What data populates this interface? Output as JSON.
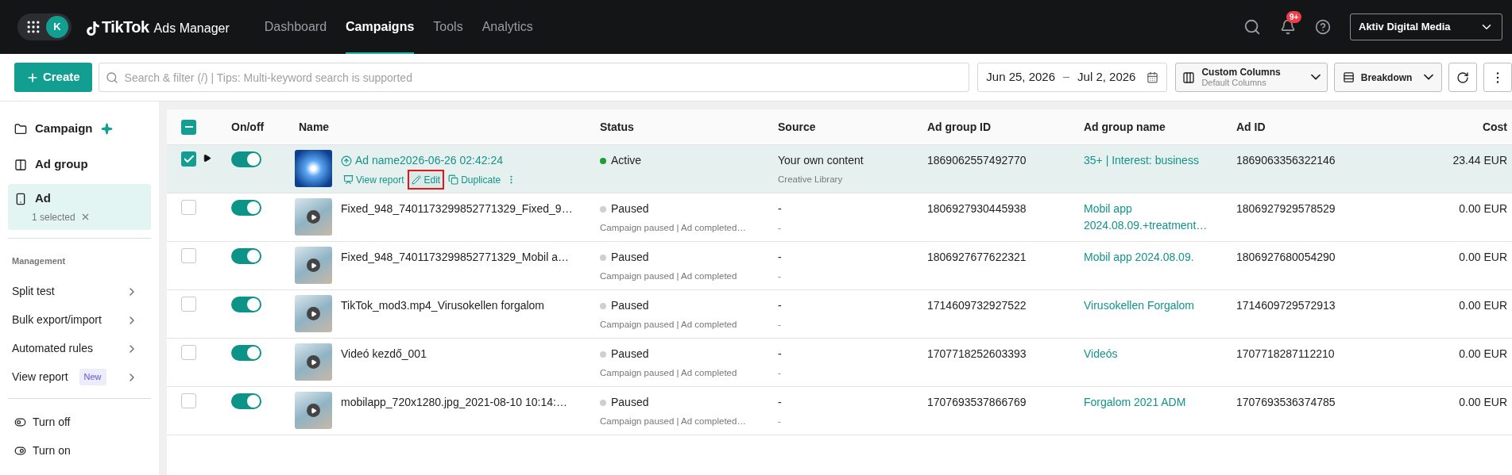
{
  "top_bar": {
    "avatar": "K",
    "logo": {
      "brand": "TikTok",
      "product": "Ads Manager"
    },
    "nav": [
      {
        "label": "Dashboard",
        "selected": false
      },
      {
        "label": "Campaigns",
        "selected": true
      },
      {
        "label": "Tools",
        "selected": false
      },
      {
        "label": "Analytics",
        "selected": false
      }
    ],
    "notifications_badge": "9+",
    "account": "Aktiv Digital Media"
  },
  "toolbar": {
    "create": "Create",
    "search": {
      "placeholder": "Search & filter (/) | Tips: Multi-keyword search is supported"
    },
    "date_start": "Jun 25, 2026",
    "date_end": "Jul 2, 2026",
    "columns": {
      "label": "Custom Columns",
      "value": "Default Columns"
    },
    "breakdown": "Breakdown"
  },
  "sidebar": {
    "levels": [
      {
        "label": "Campaign",
        "selected": false,
        "kind": "campaign"
      },
      {
        "label": "Ad group",
        "selected": false,
        "kind": "adgroup"
      },
      {
        "label": "Ad",
        "selected": true,
        "kind": "ad",
        "note": "1 selected"
      }
    ],
    "section": "Management",
    "management": [
      {
        "label": "Split test"
      },
      {
        "label": "Bulk export/import"
      },
      {
        "label": "Automated rules"
      },
      {
        "label": "View report",
        "badge": "New"
      }
    ],
    "actions": [
      {
        "label": "Turn off",
        "kind": "off"
      },
      {
        "label": "Turn on",
        "kind": "on"
      }
    ]
  },
  "table": {
    "select_all_indeterminate": true,
    "columns": [
      "On/off",
      "Name",
      "Status",
      "Source",
      "Ad group ID",
      "Ad group name",
      "Ad ID",
      "Cost"
    ],
    "rows": [
      {
        "selected": true,
        "expandable": true,
        "on": true,
        "kind": "link",
        "name": "Ad name2026-06-26 02:42:24",
        "actions": [
          {
            "label": "View report",
            "kind": "report",
            "highlighted": false
          },
          {
            "label": "Edit",
            "kind": "edit",
            "highlighted": true
          },
          {
            "label": "Duplicate",
            "kind": "duplicate",
            "highlighted": false
          }
        ],
        "status": "Active",
        "color": "#1f9d3a",
        "source": "Your own content",
        "source_note": "Creative Library",
        "ad_group_id": "1869062557492770",
        "ad_group_name": "35+ | Interest: business",
        "ad_id": "1869063356322146",
        "cost": "23.44 EUR"
      },
      {
        "selected": false,
        "expandable": false,
        "on": true,
        "kind": "plain",
        "name": "Fixed_948_7401173299852771329_Fixed_9…",
        "status": "Paused",
        "color": "#cfcfcf",
        "status_note": "Campaign paused | Ad completed…",
        "source": "-",
        "source_note": "-",
        "ad_group_id": "1806927930445938",
        "ad_group_name": "Mobil app 2024.08.09.+treatment…",
        "ad_id": "1806927929578529",
        "cost": "0.00 EUR"
      },
      {
        "selected": false,
        "expandable": false,
        "on": true,
        "kind": "plain",
        "name": "Fixed_948_7401173299852771329_Mobil a…",
        "status": "Paused",
        "color": "#cfcfcf",
        "status_note": "Campaign paused | Ad completed",
        "source": "-",
        "source_note": "-",
        "ad_group_id": "1806927677622321",
        "ad_group_name": "Mobil app 2024.08.09.",
        "ad_id": "1806927680054290",
        "cost": "0.00 EUR"
      },
      {
        "selected": false,
        "expandable": false,
        "on": true,
        "kind": "plain",
        "name": "TikTok_mod3.mp4_Virusokellen forgalom",
        "status": "Paused",
        "color": "#cfcfcf",
        "status_note": "Campaign paused | Ad completed",
        "source": "-",
        "source_note": "-",
        "ad_group_id": "1714609732927522",
        "ad_group_name": "Virusokellen Forgalom",
        "ad_id": "1714609729572913",
        "cost": "0.00 EUR"
      },
      {
        "selected": false,
        "expandable": false,
        "on": true,
        "kind": "plain",
        "name": "Videó kezdő_001",
        "status": "Paused",
        "color": "#cfcfcf",
        "status_note": "Campaign paused | Ad completed",
        "source": "-",
        "source_note": "-",
        "ad_group_id": "1707718252603393",
        "ad_group_name": "Videós",
        "ad_id": "1707718287112210",
        "cost": "0.00 EUR"
      },
      {
        "selected": false,
        "expandable": false,
        "on": true,
        "kind": "plain",
        "name": "mobilapp_720x1280.jpg_2021-08-10 10:14:…",
        "status": "Paused",
        "color": "#cfcfcf",
        "status_note": "Campaign paused | Ad completed…",
        "source": "-",
        "source_note": "-",
        "ad_group_id": "1707693537866769",
        "ad_group_name": "Forgalom 2021 ADM",
        "ad_id": "1707693536374785",
        "cost": "0.00 EUR"
      }
    ]
  }
}
